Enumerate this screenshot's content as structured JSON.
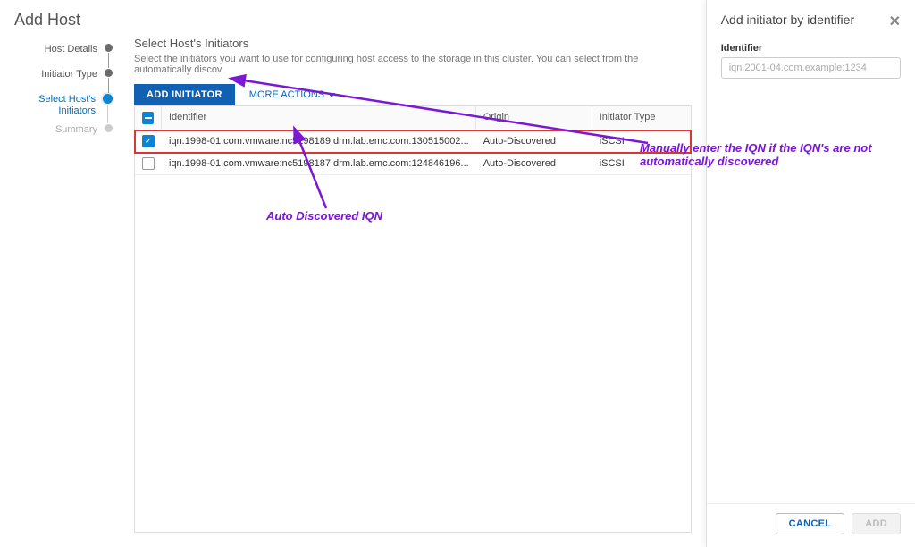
{
  "wizard": {
    "title": "Add Host",
    "steps": [
      {
        "label": "Host Details",
        "state": "done"
      },
      {
        "label": "Initiator Type",
        "state": "done"
      },
      {
        "label": "Select Host's Initiators",
        "state": "active"
      },
      {
        "label": "Summary",
        "state": "future"
      }
    ]
  },
  "content": {
    "title": "Select Host's Initiators",
    "description": "Select the initiators you want to use for configuring host access to the storage in this cluster. You can select from the automatically discov"
  },
  "toolbar": {
    "add_initiator_label": "ADD INITIATOR",
    "more_actions_label": "MORE ACTIONS"
  },
  "table": {
    "headers": {
      "identifier": "Identifier",
      "origin": "Origin",
      "type": "Initiator Type"
    },
    "rows": [
      {
        "checked": true,
        "identifier": "iqn.1998-01.com.vmware:nc5198189.drm.lab.emc.com:130515002...",
        "origin": "Auto-Discovered",
        "type": "iSCSI",
        "highlight": true
      },
      {
        "checked": false,
        "identifier": "iqn.1998-01.com.vmware:nc5198187.drm.lab.emc.com:124846196...",
        "origin": "Auto-Discovered",
        "type": "iSCSI",
        "highlight": false
      }
    ]
  },
  "side_panel": {
    "title": "Add initiator by identifier",
    "field_label": "Identifier",
    "placeholder": "iqn.2001-04.com.example:1234",
    "cancel_label": "CANCEL",
    "add_label": "ADD"
  },
  "annotations": {
    "auto": "Auto Discovered IQN",
    "manual": "Manually enter the IQN if the IQN's are not automatically discovered"
  },
  "colors": {
    "accent": "#1260b2",
    "annotation": "#7a18d6",
    "highlight_border": "#d93636"
  }
}
